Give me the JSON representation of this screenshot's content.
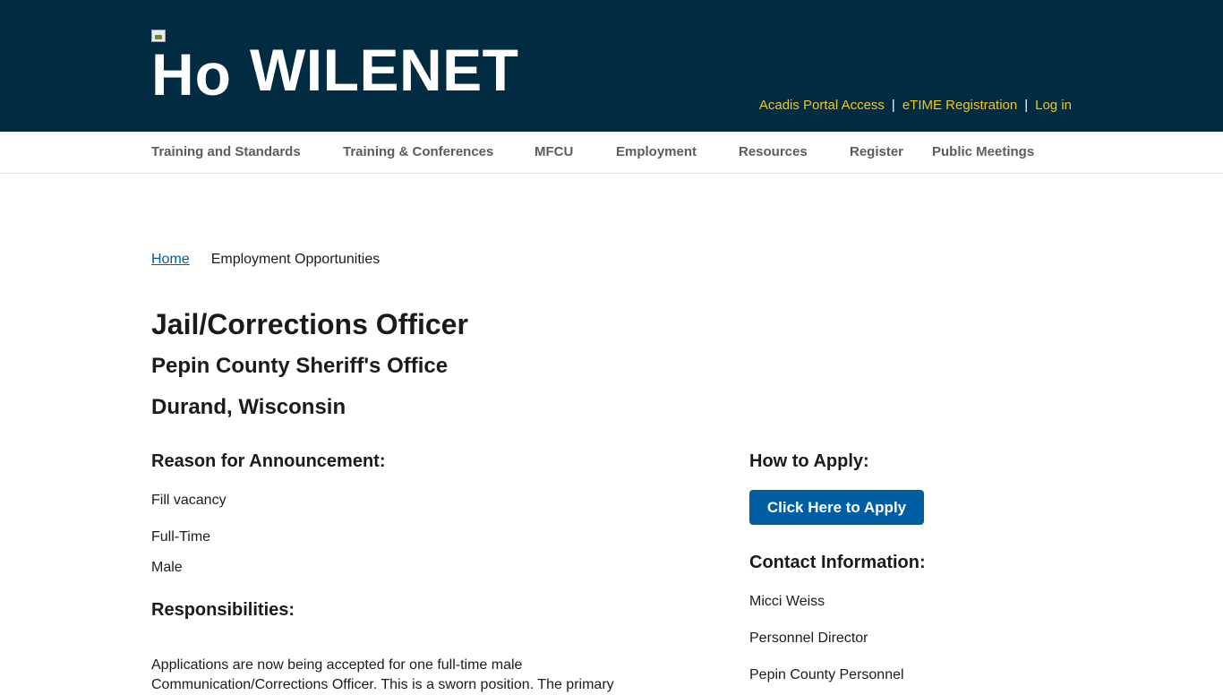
{
  "header": {
    "logo_alt": "Ho",
    "site_name": "WILENET",
    "utility_links": [
      {
        "label": "Acadis Portal Access"
      },
      {
        "label": "eTIME Registration"
      },
      {
        "label": "Log in"
      }
    ],
    "separator": "|"
  },
  "nav": {
    "items": [
      {
        "label": "Training and Standards"
      },
      {
        "label": "Training & Conferences"
      },
      {
        "label": "MFCU"
      },
      {
        "label": "Employment"
      },
      {
        "label": "Resources"
      },
      {
        "label": "Register"
      },
      {
        "label": "Public Meetings"
      }
    ]
  },
  "breadcrumb": {
    "home": "Home",
    "current": "Employment Opportunities"
  },
  "job": {
    "title": "Jail/Corrections Officer",
    "agency": "Pepin County Sheriff's Office",
    "location": "Durand, Wisconsin"
  },
  "left": {
    "reason_heading": "Reason for Announcement:",
    "reason": "Fill vacancy",
    "employment_type": "Full-Time",
    "gender": "Male",
    "responsibilities_heading": "Responsibilities:",
    "responsibilities_text": "Applications are now being accepted for one full-time male Communication/Corrections Officer. This is a sworn position. The primary"
  },
  "right": {
    "apply_heading": "How to Apply:",
    "apply_button": "Click Here to Apply",
    "contact_heading": "Contact Information:",
    "contact_name": "Micci Weiss",
    "contact_title": "Personnel Director",
    "contact_org": "Pepin County Personnel"
  },
  "colors": {
    "header_bg": "#002b40",
    "util_link": "#f5c518",
    "link": "#005ea2",
    "button_bg": "#005ea2"
  }
}
